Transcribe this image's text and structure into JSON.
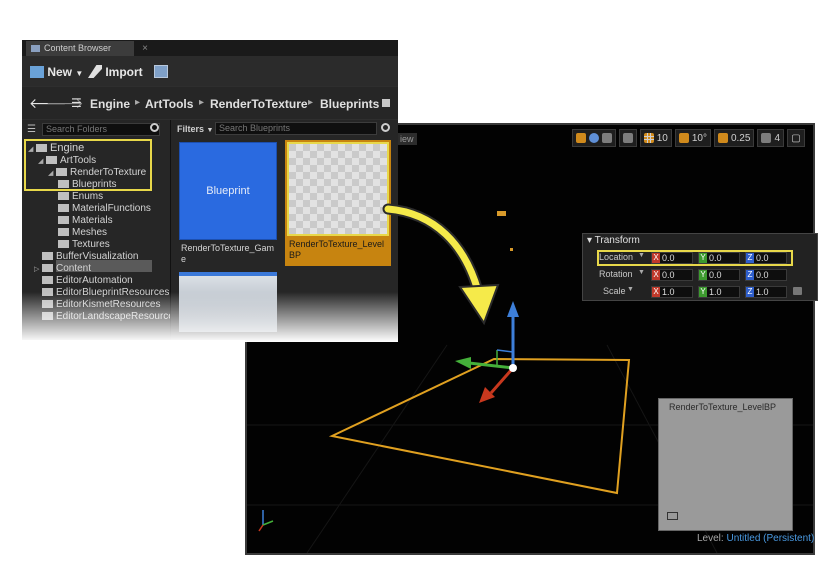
{
  "content_browser": {
    "tab_title": "Content Browser",
    "toolbar": {
      "new_label": "New",
      "import_label": "Import"
    },
    "breadcrumb": [
      "Engine",
      "ArtTools",
      "RenderToTexture",
      "Blueprints"
    ],
    "folder_search_placeholder": "Search Folders",
    "asset_search_placeholder": "Search Blueprints",
    "filters_label": "Filters",
    "tree": [
      "Engine",
      "ArtTools",
      "RenderToTexture",
      "Blueprints",
      "Enums",
      "MaterialFunctions",
      "Materials",
      "Meshes",
      "Textures",
      "BufferVisualization",
      "Content",
      "EditorAutomation",
      "EditorBlueprintResources",
      "EditorKismetResources",
      "EditorLandscapeResources"
    ],
    "assets": [
      {
        "thumb_label": "Blueprint",
        "name": "RenderToTexture_Game"
      },
      {
        "name": "RenderToTexture_LevelBP"
      }
    ]
  },
  "viewport": {
    "view_mode_fragment": "iew",
    "toolbar_values": {
      "grid_snap": "10",
      "rotation_snap": "10°",
      "scale_snap": "0.25",
      "camera_speed": "4"
    },
    "transform": {
      "title": "Transform",
      "rows": [
        {
          "label": "Location",
          "x": "0.0",
          "y": "0.0",
          "z": "0.0"
        },
        {
          "label": "Rotation",
          "x": "0.0",
          "y": "0.0",
          "z": "0.0"
        },
        {
          "label": "Scale",
          "x": "1.0",
          "y": "1.0",
          "z": "1.0"
        }
      ]
    },
    "preview_title": "RenderToTexture_LevelBP",
    "level_label": "Level:",
    "level_name": "Untitled (Persistent)"
  },
  "colors": {
    "highlight": "#e8d84a",
    "selection_orange": "#e0a020",
    "asset_blue": "#2a6ae0",
    "level_link": "#4a9ae2"
  },
  "icons": [
    "content-browser-icon",
    "new-asset-icon",
    "import-icon",
    "save-all-icon",
    "back-icon",
    "forward-icon",
    "path-menu-icon",
    "lock-icon",
    "search-icon",
    "folder-icon",
    "curved-arrow-icon",
    "translate-gizmo-icon",
    "axis-indicator-icon"
  ]
}
